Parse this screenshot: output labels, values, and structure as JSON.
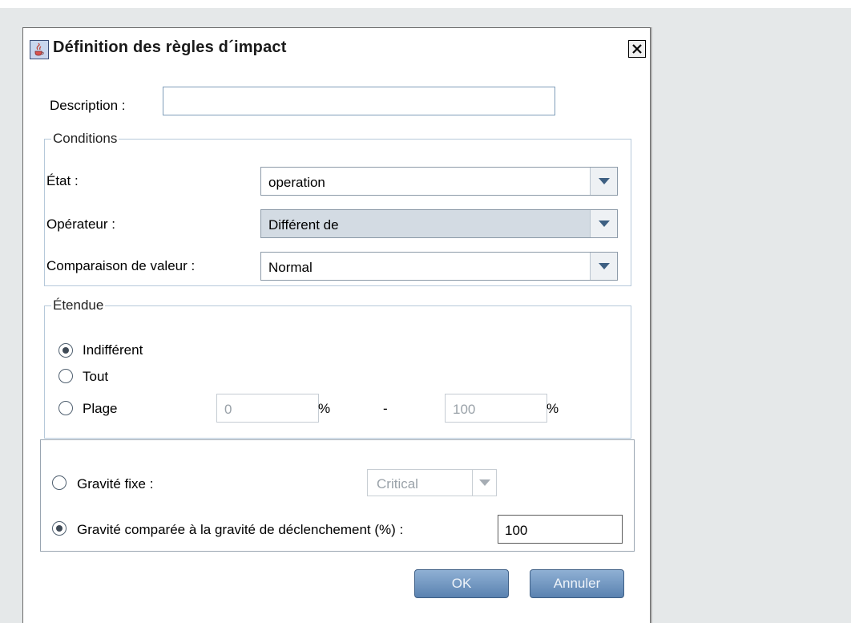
{
  "dialog": {
    "title": "Définition des règles d´impact",
    "close_glyph": "✕"
  },
  "description": {
    "label": "Description :",
    "value": ""
  },
  "conditions": {
    "legend": "Conditions",
    "state_label": "État :",
    "state_value": "operation",
    "operator_label": "Opérateur :",
    "operator_value": "Différent de",
    "compare_label": "Comparaison de valeur :",
    "compare_value": "Normal"
  },
  "scope": {
    "legend": "Étendue",
    "options": [
      "Indifférent",
      "Tout",
      "Plage"
    ],
    "selected": "Indifférent",
    "range_from": "0",
    "range_to": "100",
    "percent": "%",
    "dash": "-"
  },
  "severity": {
    "fixed_label": "Gravité fixe :",
    "fixed_value": "Critical",
    "relative_label": "Gravité comparée à la gravité de déclenchement (%) :",
    "relative_value": "100",
    "selected": "relative"
  },
  "buttons": {
    "ok": "OK",
    "cancel": "Annuler"
  },
  "colors": {
    "accent": "#5a82b0",
    "border": "#b6c9da",
    "background": "#e5e8e9"
  },
  "icons": {
    "app": "java-cup-icon",
    "close": "close-icon",
    "dropdown": "chevron-down-icon"
  }
}
